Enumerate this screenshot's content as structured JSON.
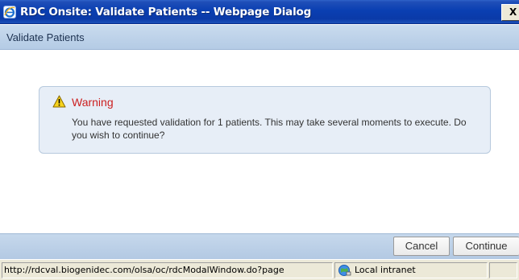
{
  "window": {
    "title": "RDC Onsite: Validate Patients -- Webpage Dialog",
    "close_label": "X",
    "app_icon": "ie-icon"
  },
  "dialog": {
    "header_title": "Validate Patients"
  },
  "warning": {
    "icon": "warning-icon",
    "title": "Warning",
    "message": "You have requested validation for 1 patients. This may take several moments to execute. Do you wish to continue?",
    "title_color": "#cc1f1f"
  },
  "buttons": {
    "cancel_label": "Cancel",
    "continue_label": "Continue"
  },
  "statusbar": {
    "url": "http://rdcval.biogenidec.com/olsa/oc/rdcModalWindow.do?page",
    "zone_icon": "local-intranet-icon",
    "zone_label": "Local intranet"
  },
  "colors": {
    "titlebar": "#0a3fb2",
    "header_bg": "#c9dbee",
    "warning_box_bg": "#e7eef7"
  }
}
